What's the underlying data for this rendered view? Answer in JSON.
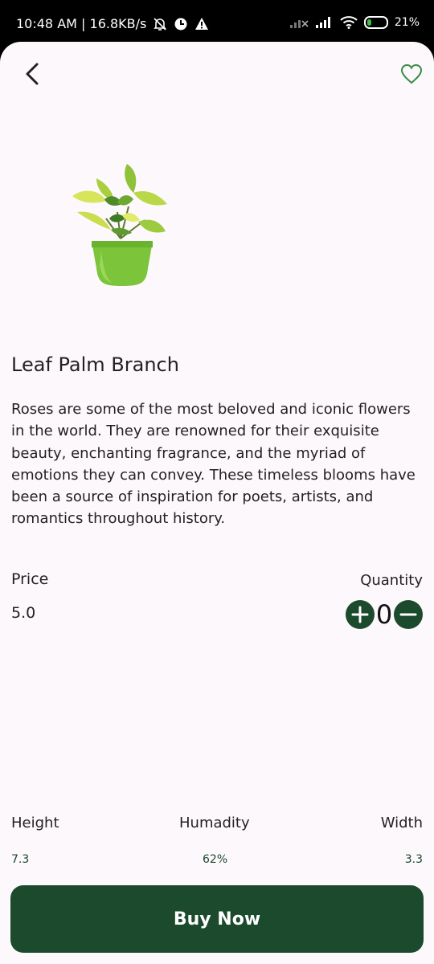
{
  "status_bar": {
    "time_speed": "10:48 AM | 16.8KB/s",
    "battery": "21%",
    "battery_level": 0.21
  },
  "product": {
    "name": "Leaf Palm Branch",
    "description": "Roses are some of the most beloved and iconic flowers in the world. They are renowned for their exquisite beauty, enchanting fragrance, and the myriad of emotions they can convey. These timeless blooms have been a source of inspiration for poets, artists, and romantics throughout history.",
    "price_label": "Price",
    "price": "5.0",
    "quantity_label": "Quantity",
    "quantity": "0"
  },
  "stats": {
    "height_label": "Height",
    "height": "7.3",
    "humidity_label": "Humadity",
    "humidity": "62%",
    "width_label": "Width",
    "width": "3.3"
  },
  "actions": {
    "buy_label": "Buy Now"
  },
  "icons": {
    "back": "chevron-left-icon",
    "favorite": "heart-outline-icon",
    "plus": "plus-icon",
    "minus": "minus-icon"
  },
  "colors": {
    "primary": "#1b4a2c",
    "favorite": "#3c8c46",
    "background": "#fdf8fc"
  }
}
